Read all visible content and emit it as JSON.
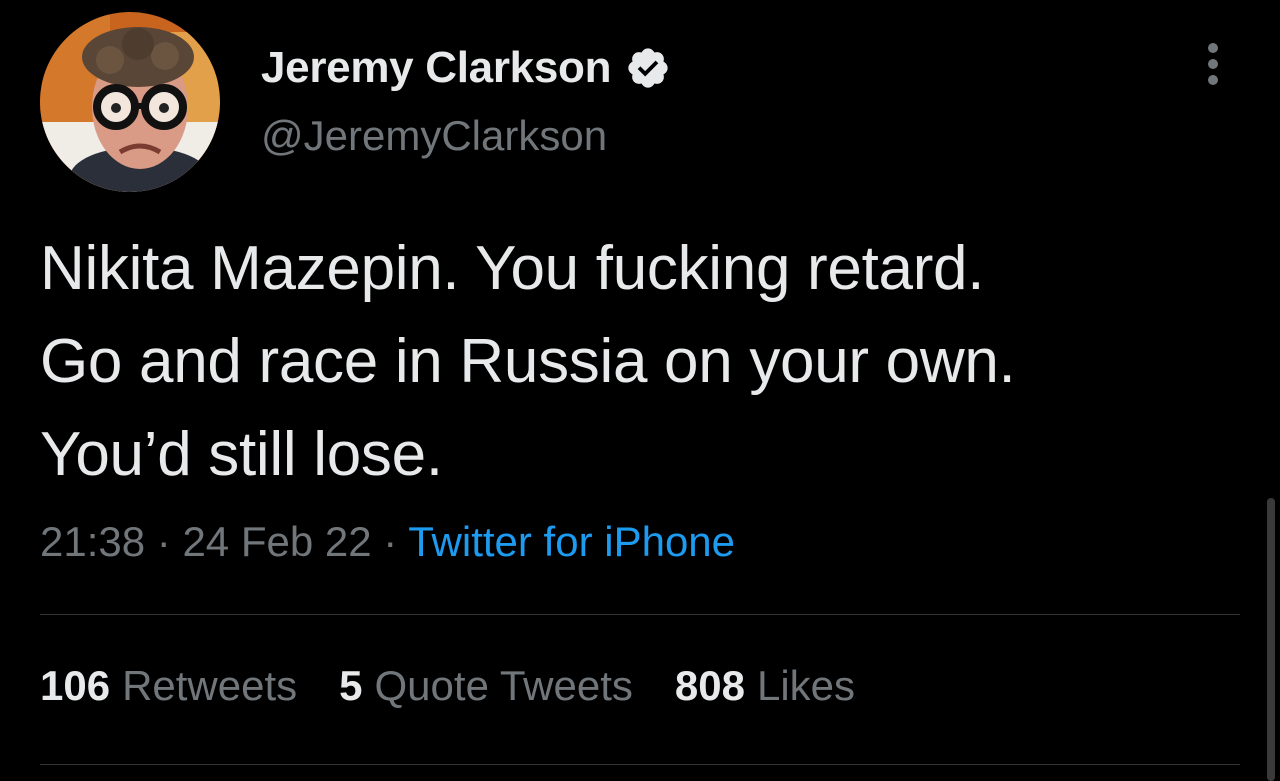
{
  "author": {
    "display_name": "Jeremy Clarkson",
    "handle": "@JeremyClarkson",
    "verified": true
  },
  "tweet": {
    "lines": [
      "Nikita Mazepin. You fucking retard.",
      "Go and race in Russia on your own.",
      "You’d still lose."
    ],
    "time": "21:38",
    "separator": "·",
    "date": "24 Feb 22",
    "source": "Twitter for iPhone"
  },
  "stats": {
    "retweets_count": "106",
    "retweets_label": "Retweets",
    "quotes_count": "5",
    "quotes_label": "Quote Tweets",
    "likes_count": "808",
    "likes_label": "Likes"
  },
  "icons": {
    "verified": "verified-badge-icon",
    "more": "more-vertical-icon"
  },
  "colors": {
    "background": "#000000",
    "text": "#e7e9ea",
    "secondary": "#71767b",
    "link": "#1d9bf0",
    "divider": "#2f3336"
  }
}
